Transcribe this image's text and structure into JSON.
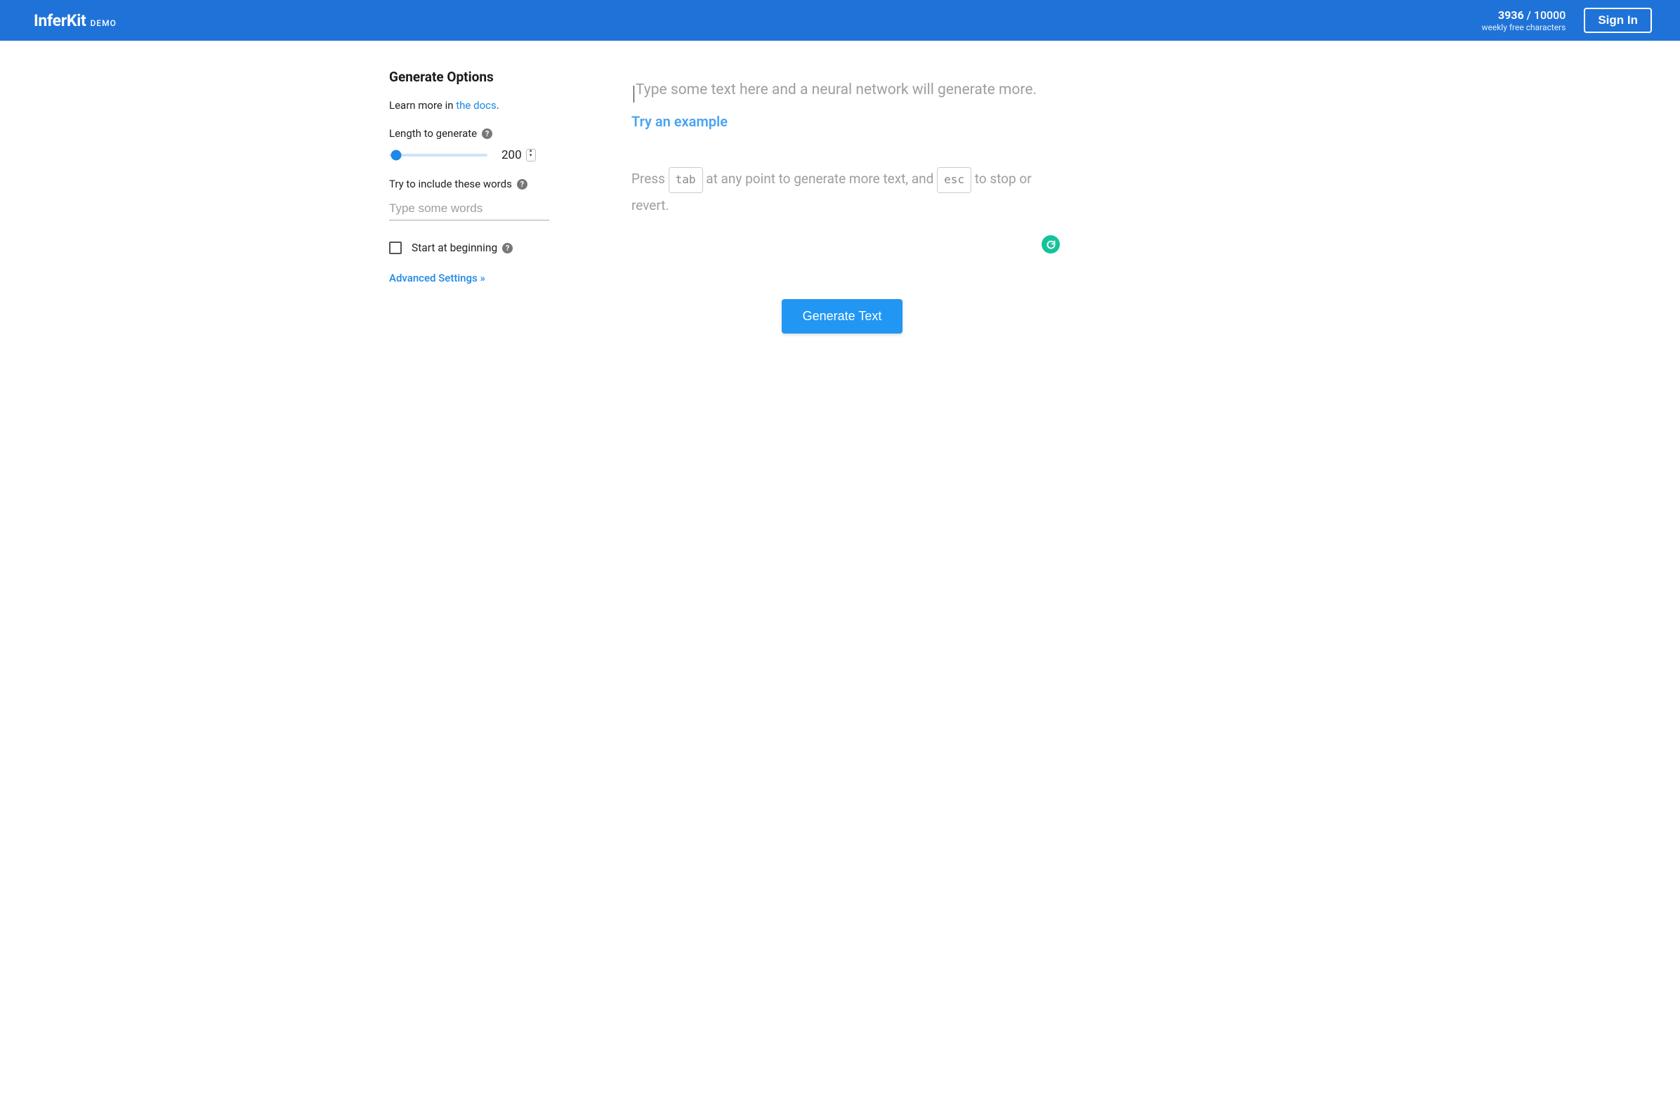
{
  "header": {
    "brand_name": "InferKit",
    "brand_suffix": "DEMO",
    "char_count_used": "3936",
    "char_count_sep": " / ",
    "char_count_total": "10000",
    "char_count_label": "weekly free characters",
    "signin_label": "Sign In"
  },
  "sidebar": {
    "title": "Generate Options",
    "learn_more_prefix": "Learn more in ",
    "docs_link_label": "the docs",
    "learn_more_suffix": ".",
    "length_label": "Length to generate",
    "length_value": "200",
    "slider_percent": 7,
    "include_label": "Try to include these words",
    "include_placeholder": "Type some words",
    "start_beginning_label": "Start at beginning",
    "advanced_label": "Advanced Settings »",
    "help_glyph": "?"
  },
  "main": {
    "placeholder": "Type some text here and a neural network will generate more.",
    "try_example_label": "Try an example",
    "hint_press": "Press ",
    "hint_tab_key": "tab",
    "hint_mid": " at any point to generate more text, and ",
    "hint_esc_key": "esc",
    "hint_end": " to stop or revert.",
    "generate_label": "Generate Text"
  }
}
